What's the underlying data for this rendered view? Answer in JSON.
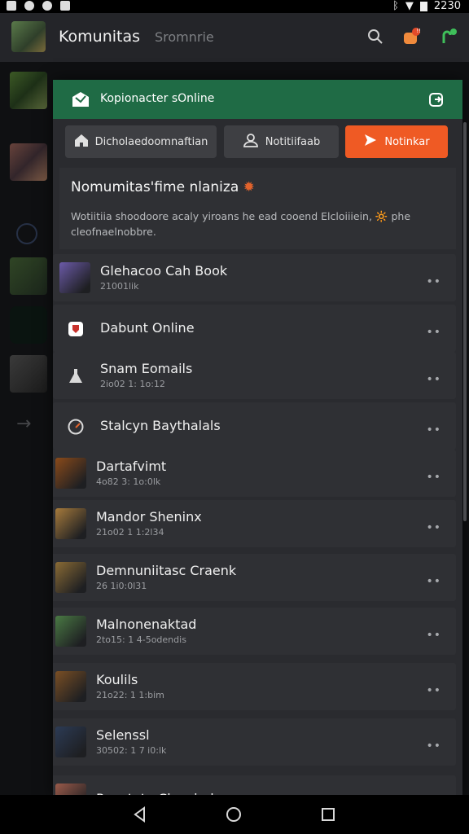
{
  "status": {
    "time": "2230"
  },
  "header": {
    "title": "Komunitas",
    "subtitle": "Sromnrie",
    "badge": "!!"
  },
  "panel": {
    "title": "Kopionacter sOnline",
    "actions": [
      {
        "label": "Dicholaedoomnaftian",
        "icon": "home-icon"
      },
      {
        "label": "Notitiifaab",
        "icon": "user-outline-icon"
      },
      {
        "label": "Notinkar",
        "icon": "send-icon"
      }
    ],
    "notice": {
      "heading": "Nomumitas'fime nlaniza",
      "body": "Wotiitiia shoodoore acaly yiroans he ead cooend Elcloiiiein, 🔆 phe cleofnaelnobbre."
    },
    "items": [
      {
        "name": "Glehacoo Cah Book",
        "meta": "21001lik",
        "icon": "game-thumbnail-1",
        "color": "#6b5aa8"
      },
      {
        "name": "Dabunt Online",
        "meta": "",
        "icon": "shield-logo-icon",
        "color": "#c9332e"
      },
      {
        "name": "Snam Eomails",
        "meta": "2io02 1: 1o:12",
        "icon": "flask-icon",
        "color": "#d9d9d9"
      },
      {
        "name": "Stalcyn Baythalals",
        "meta": "",
        "icon": "speedometer-icon",
        "color": "#d9d9d9"
      },
      {
        "name": "Dartafvimt",
        "meta": "4o82 3: 1o:0lk",
        "icon": "game-thumbnail-2",
        "color": "#8a4a1a"
      },
      {
        "name": "Mandor Sheninx",
        "meta": "21o02 1 1:2l34",
        "icon": "game-thumbnail-3",
        "color": "#a77b3c"
      },
      {
        "name": "Demnuniitasc Craenk",
        "meta": "26 1i0:0l31",
        "icon": "game-thumbnail-4",
        "color": "#8a6b35"
      },
      {
        "name": "Malnonenaktad",
        "meta": "2to15: 1 4-5odendis",
        "icon": "game-thumbnail-5",
        "color": "#4a7a44"
      },
      {
        "name": "Koulils",
        "meta": "21o22: 1 1:bim",
        "icon": "game-thumbnail-6",
        "color": "#7a4f24"
      },
      {
        "name": "Selenssl",
        "meta": "30502: 1 7 i0:lk",
        "icon": "game-thumbnail-7",
        "color": "#2c3b55"
      },
      {
        "name": "Penotote Cherried",
        "meta": "",
        "icon": "game-thumbnail-8",
        "color": "#9a5a4a"
      }
    ]
  }
}
